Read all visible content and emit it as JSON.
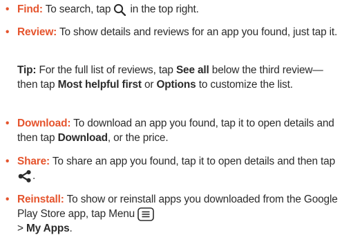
{
  "colors": {
    "accent": "#e5542d",
    "text": "#2b2b2b"
  },
  "items": [
    {
      "key": "Find:",
      "text_before_icon": " To search, tap ",
      "icon": "search-icon",
      "text_after_icon": " in the top right."
    },
    {
      "key": "Review:",
      "text": " To show details and reviews for an app you found, just tap it."
    },
    {
      "key": "Download:",
      "text_1": " To download an app you found, tap it to open details and then tap ",
      "bold_1": "Download",
      "text_2": ", or the price."
    },
    {
      "key": "Share:",
      "text_before_icon": " To share an app you found, tap it to open details and then tap ",
      "icon": "share-icon",
      "text_after_icon": "."
    },
    {
      "key": "Reinstall:",
      "text_1": " To show or reinstall apps you downloaded from the Google Play Store app, tap Menu ",
      "icon": "menu-icon",
      "text_2": " > ",
      "bold_1": "My Apps",
      "text_3": "."
    }
  ],
  "tip": {
    "key": "Tip:",
    "text_1": " For the full list of reviews, tap ",
    "bold_1": "See all",
    "text_2": " below the third review—then tap ",
    "bold_2": "Most helpful first",
    "text_3": " or ",
    "bold_3": "Options",
    "text_4": " to customize the list."
  }
}
